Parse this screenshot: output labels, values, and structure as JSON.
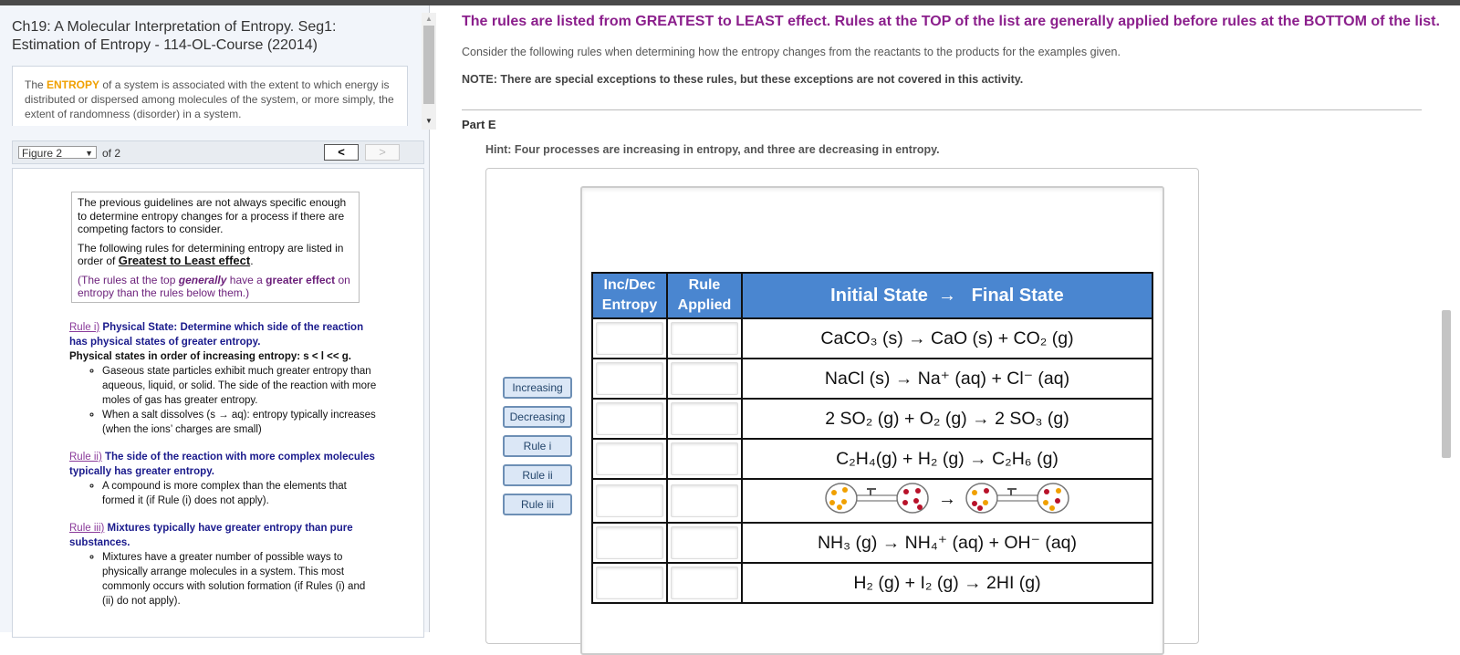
{
  "left_panel": {
    "course_title": "Ch19: A Molecular Interpretation of Entropy. Seg1: Estimation of Entropy - 114-OL-Course (22014)",
    "intro": {
      "before": "The ",
      "highlight": "ENTROPY",
      "after": " of a system is associated with the extent to which energy is distributed or dispersed among molecules of the system, or more simply, the extent of randomness (disorder) in a system."
    },
    "figure_select": "Figure 2",
    "figure_of": "of 2",
    "nav_prev": "<",
    "nav_next": ">",
    "guidelines": {
      "p1": "The previous guidelines are not always specific enough to determine entropy changes for a process if there are competing factors to consider.",
      "p2_before": "The following rules for determining entropy are listed in order of ",
      "p2_big": "Greatest to Least effect",
      "p2_after": ".",
      "p3_a": "(The rules at the top ",
      "p3_b": "generally",
      "p3_c": " have a ",
      "p3_d": "greater effect",
      "p3_e": " on entropy than the rules below them.)"
    },
    "rules": [
      {
        "tag": "Rule i)",
        "title": " Physical State: Determine which side of the reaction has physical states of greater entropy.",
        "sub": "Physical states in order of increasing entropy:   s <  l  << g.",
        "bullets": [
          "Gaseous state particles exhibit much greater entropy than aqueous, liquid, or solid. The side of the reaction with more moles of gas has greater entropy.",
          "When a salt dissolves (s → aq): entropy typically increases (when the ions’ charges are small)"
        ]
      },
      {
        "tag": "Rule ii)",
        "title": " The side of the reaction with more complex molecules typically has greater entropy.",
        "sub": "",
        "bullets": [
          "A compound is more complex than the elements that formed it (if Rule (i) does not apply)."
        ]
      },
      {
        "tag": "Rule iii)",
        "title": " Mixtures typically have greater entropy than pure substances.",
        "sub": "",
        "bullets": [
          "Mixtures have a greater number of possible ways to physically arrange molecules in a system. This most commonly occurs with solution formation (if Rules (i) and (ii) do not apply)."
        ]
      }
    ]
  },
  "main": {
    "headline": "The rules are listed from GREATEST to LEAST effect. Rules at the TOP of the list are generally applied before rules at the BOTTOM of the list.",
    "consider": "Consider the following rules when determining how the entropy changes from the reactants to the products for the examples given.",
    "note": "NOTE: There are special exceptions to these rules, but these exceptions are not covered in this activity.",
    "part": "Part E",
    "hint": "Hint: Four processes are increasing in entropy, and three are decreasing in entropy.",
    "chips": [
      "Increasing",
      "Decreasing",
      "Rule i",
      "Rule ii",
      "Rule iii"
    ],
    "table": {
      "h1a": "Inc/Dec",
      "h1b": "Entropy",
      "h2a": "Rule",
      "h2b": "Applied",
      "h3a": "Initial State",
      "h3b": "Final State",
      "rows": [
        "CaCO₃ (s)  →  CaO (s)  +  CO₂ (g)",
        "NaCl (s)  →  Na⁺ (aq)  +  Cl⁻ (aq)",
        "2 SO₂ (g)  +  O₂ (g)  →  2 SO₃ (g)",
        "C₂H₄(g)  +  H₂ (g)  → C₂H₆ (g)",
        "",
        "NH₃ (g)  →  NH₄⁺ (aq)  +  OH⁻ (aq)",
        "H₂ (g)  +  I₂ (g)  →  2HI (g)"
      ]
    },
    "colors": {
      "headline": "#8b1f8c",
      "header_fill": "#4a86d0",
      "gas_yellow": "#f0a000",
      "gas_red": "#b8122a"
    }
  }
}
